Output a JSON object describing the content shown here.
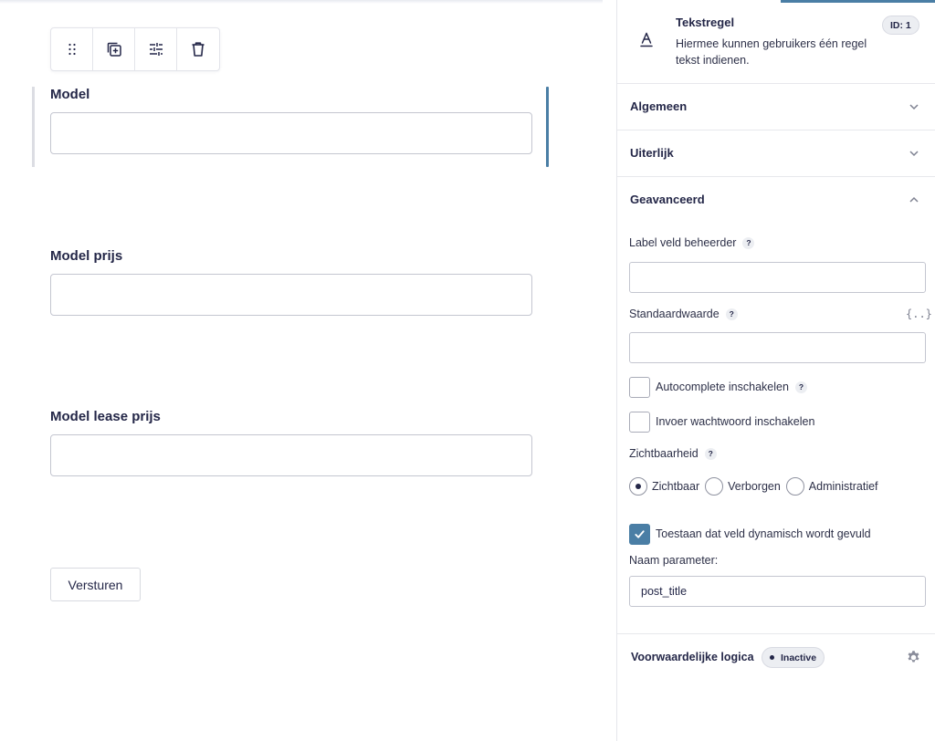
{
  "canvas": {
    "toolbar": {
      "drag_icon": "drag-handle-icon",
      "duplicate_icon": "duplicate-icon",
      "settings_icon": "sliders-icon",
      "delete_icon": "trash-icon"
    },
    "fields": [
      {
        "label": "Model"
      },
      {
        "label": "Model prijs"
      },
      {
        "label": "Model lease prijs"
      }
    ],
    "submit_label": "Versturen"
  },
  "sidebar": {
    "block": {
      "title": "Tekstregel",
      "description": "Hiermee kunnen gebruikers één regel tekst indienen.",
      "id_badge": "ID: 1",
      "icon": "text-a-icon"
    },
    "panels": {
      "general": "Algemeen",
      "appearance": "Uiterlijk",
      "advanced": "Geavanceerd"
    },
    "advanced": {
      "admin_label": "Label veld beheerder",
      "admin_value": "",
      "default_label": "Standaardwaarde",
      "default_value": "",
      "merge_tag": "{..}",
      "autocomplete_label": "Autocomplete inschakelen",
      "password_label": "Invoer wachtwoord inschakelen",
      "visibility_label": "Zichtbaarheid",
      "visibility_options": [
        "Zichtbaar",
        "Verborgen",
        "Administratief"
      ],
      "visibility_selected": "Zichtbaar",
      "dynamic_label": "Toestaan dat veld dynamisch wordt gevuld",
      "dynamic_checked": true,
      "param_label": "Naam parameter:",
      "param_value": "post_title",
      "help_mark": "?"
    },
    "logic": {
      "title": "Voorwaardelijke logica",
      "status": "Inactive"
    }
  },
  "colors": {
    "accent": "#4a7ea5",
    "text": "#242748",
    "border": "#c4c6d0"
  }
}
